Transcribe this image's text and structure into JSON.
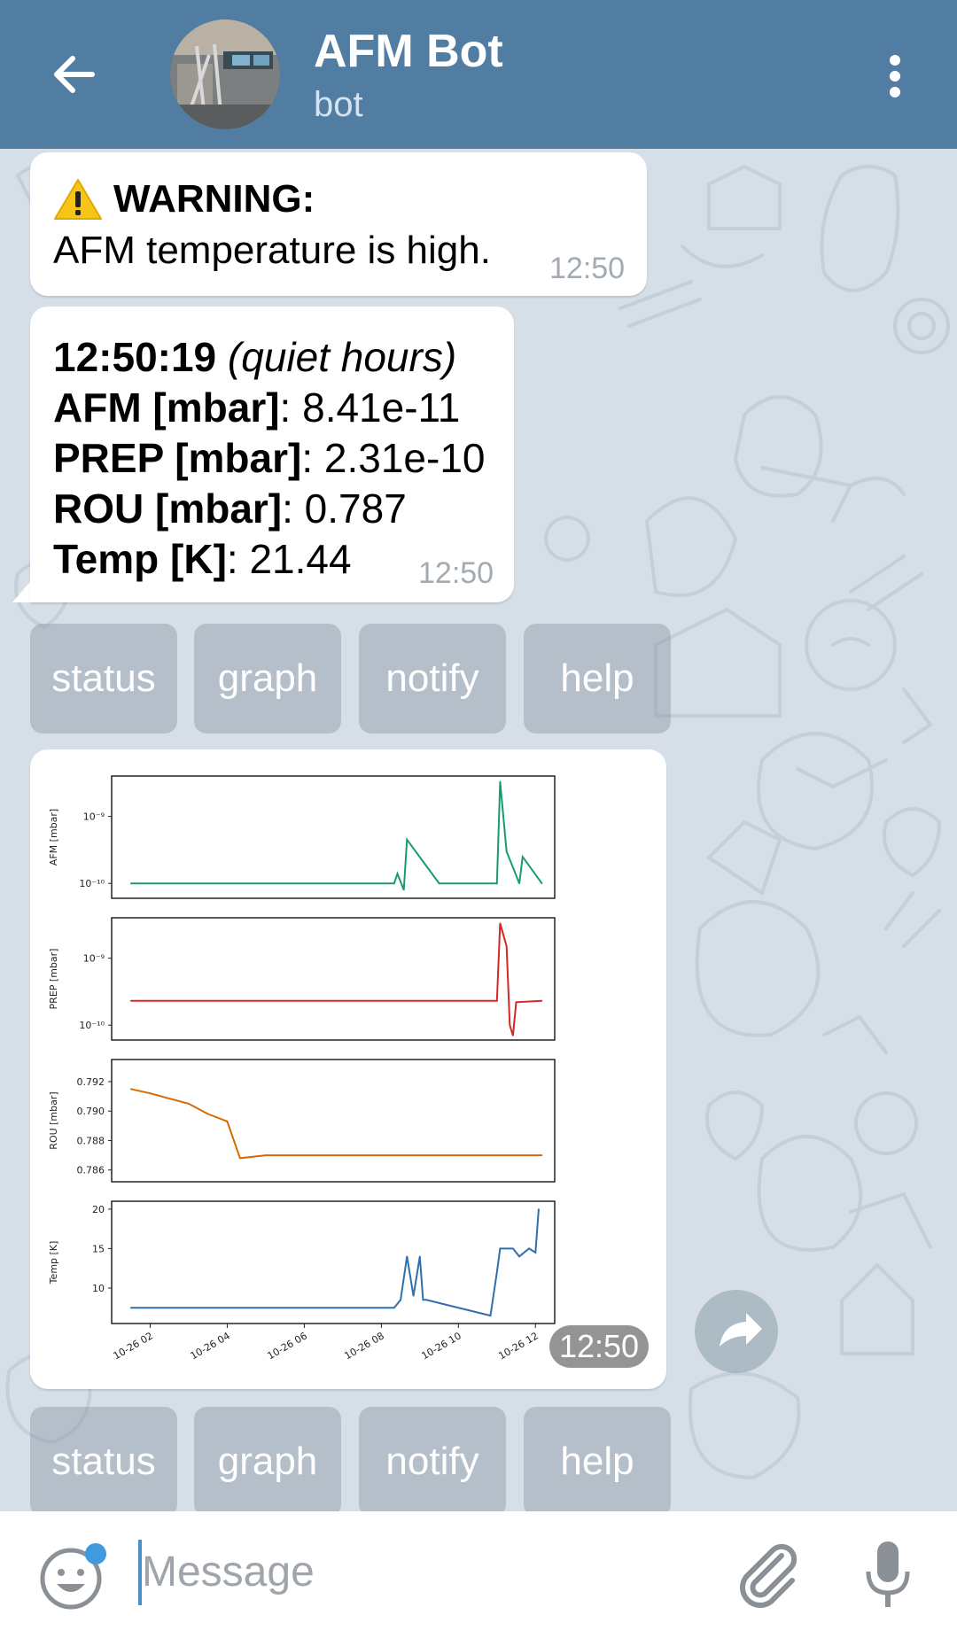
{
  "header": {
    "title": "AFM Bot",
    "subtitle": "bot",
    "back_icon": "arrow-left-icon",
    "menu_icon": "more-vertical-icon",
    "avatar_icon": "bot-avatar-photo",
    "bg_color": "#527da3"
  },
  "messages": [
    {
      "type": "warning",
      "icon": "warning-icon",
      "title": "WARNING:",
      "text": "AFM temperature is high.",
      "time": "12:50"
    },
    {
      "type": "status",
      "time_label": "12:50:19",
      "note": "(quiet hours)",
      "afm_label": "AFM [mbar]",
      "afm_value": ": 8.41e-11",
      "prep_label": "PREP [mbar]",
      "prep_value": ": 2.31e-10",
      "rou_label": "ROU [mbar]",
      "rou_value": ": 0.787",
      "temp_label": "Temp [K]",
      "temp_value": ": 21.44",
      "time": "12:50"
    },
    {
      "type": "photo",
      "time": "12:50",
      "share_icon": "forward-arrow-icon"
    }
  ],
  "keyboard1": [
    "status",
    "graph",
    "notify",
    "help"
  ],
  "keyboard2": [
    "status",
    "graph",
    "notify",
    "help"
  ],
  "input": {
    "placeholder": "Message",
    "emoji_icon": "emoji-smile-icon",
    "attach_icon": "paperclip-icon",
    "mic_icon": "microphone-icon"
  },
  "chart_data": [
    {
      "type": "line",
      "ylabel": "AFM [mbar]",
      "yscale": "log",
      "yticks": [
        "10⁻¹⁰",
        "10⁻⁹"
      ],
      "ylim": [
        6e-11,
        4e-09
      ],
      "color": "#1a9a73",
      "x": [
        "10-26 01:30",
        "10-26 08:20",
        "10-26 08:25",
        "10-26 08:35",
        "10-26 08:40",
        "10-26 09:30",
        "10-26 11:00",
        "10-26 11:05",
        "10-26 11:15",
        "10-26 11:35",
        "10-26 11:40",
        "10-26 12:10"
      ],
      "values": [
        1e-10,
        1e-10,
        1.4e-10,
        8e-11,
        4.5e-10,
        1e-10,
        1e-10,
        3.3e-09,
        3e-10,
        1e-10,
        2.5e-10,
        1e-10
      ]
    },
    {
      "type": "line",
      "ylabel": "PREP [mbar]",
      "yscale": "log",
      "yticks": [
        "10⁻¹⁰",
        "10⁻⁹"
      ],
      "ylim": [
        6e-11,
        4e-09
      ],
      "color": "#d62728",
      "x": [
        "10-26 01:30",
        "10-26 11:00",
        "10-26 11:05",
        "10-26 11:15",
        "10-26 11:20",
        "10-26 11:25",
        "10-26 11:30",
        "10-26 12:10"
      ],
      "values": [
        2.3e-10,
        2.3e-10,
        3.3e-09,
        1.5e-09,
        1e-10,
        7e-11,
        2.2e-10,
        2.31e-10
      ]
    },
    {
      "type": "line",
      "ylabel": "ROU [mbar]",
      "ylim": [
        0.7852,
        0.7935
      ],
      "yticks": [
        "0.786",
        "0.788",
        "0.790",
        "0.792"
      ],
      "color": "#d46a00",
      "x": [
        "10-26 01:30",
        "10-26 02:00",
        "10-26 03:00",
        "10-26 03:30",
        "10-26 04:00",
        "10-26 04:20",
        "10-26 05:00",
        "10-26 12:10"
      ],
      "values": [
        0.7915,
        0.7912,
        0.7905,
        0.7898,
        0.7893,
        0.7868,
        0.787,
        0.787
      ]
    },
    {
      "type": "line",
      "ylabel": "Temp [K]",
      "ylim": [
        5.5,
        21
      ],
      "yticks": [
        "10",
        "15",
        "20"
      ],
      "color": "#2f6fad",
      "xticks": [
        "10-26 02",
        "10-26 04",
        "10-26 06",
        "10-26 08",
        "10-26 10",
        "10-26 12"
      ],
      "x": [
        "10-26 01:30",
        "10-26 08:20",
        "10-26 08:30",
        "10-26 08:40",
        "10-26 08:50",
        "10-26 09:00",
        "10-26 09:05",
        "10-26 09:10",
        "10-26 10:50",
        "10-26 11:00",
        "10-26 11:05",
        "10-26 11:25",
        "10-26 11:35",
        "10-26 11:50",
        "10-26 12:00",
        "10-26 12:05"
      ],
      "values": [
        7.5,
        7.5,
        8.5,
        14,
        9,
        14,
        8.5,
        8.5,
        6.5,
        12,
        15,
        15,
        14,
        15,
        14.5,
        20
      ]
    }
  ]
}
